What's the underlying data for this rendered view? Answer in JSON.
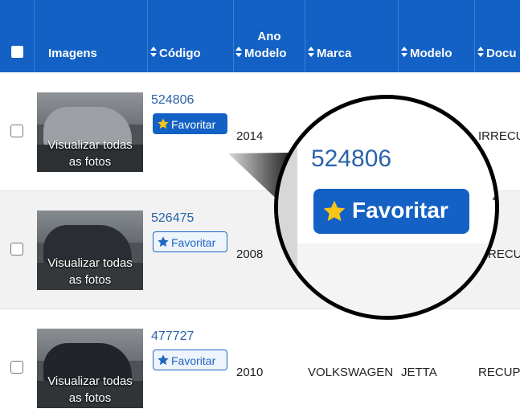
{
  "header": {
    "imagens": "Imagens",
    "codigo": "Código",
    "ano_modelo_line1": "Ano",
    "ano_modelo_line2": "Modelo",
    "marca": "Marca",
    "modelo": "Modelo",
    "documento": "Docu"
  },
  "thumb_caption_line1": "Visualizar todas",
  "thumb_caption_line2": "as fotos",
  "favorite_label": "Favoritar",
  "rows": [
    {
      "code": "524806",
      "year": "2014",
      "brand": "",
      "model": "",
      "doc": "IRRECU",
      "favorited": true
    },
    {
      "code": "526475",
      "year": "2008",
      "brand": "",
      "model": "",
      "doc": "RECU",
      "favorited": false
    },
    {
      "code": "477727",
      "year": "2010",
      "brand": "VOLKSWAGEN",
      "model": "JETTA",
      "doc": "RECUPI",
      "favorited": false
    }
  ],
  "magnifier": {
    "code": "524806",
    "label": "Favoritar",
    "partial_digit": "2"
  },
  "colors": {
    "header_bg": "#1361c4",
    "link": "#2a63a8",
    "fav_star": "#f5c518"
  }
}
